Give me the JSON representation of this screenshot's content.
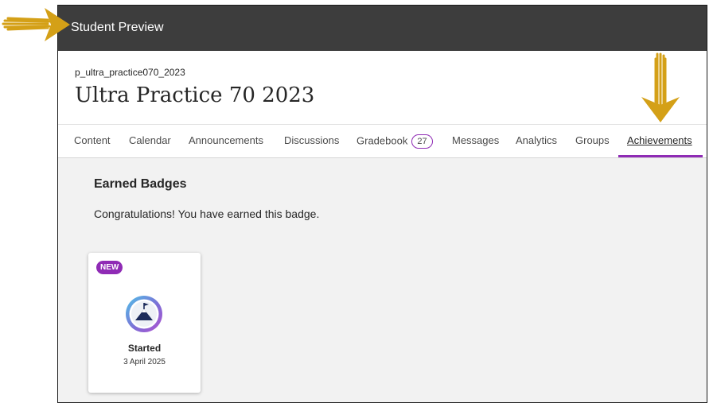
{
  "preview_bar": {
    "title": "Student Preview"
  },
  "course": {
    "id": "p_ultra_practice070_2023",
    "title": "Ultra Practice 70 2023"
  },
  "tabs": [
    {
      "label": "Content"
    },
    {
      "label": "Calendar"
    },
    {
      "label": "Announcements"
    },
    {
      "label": "Discussions"
    },
    {
      "label": "Gradebook",
      "count": "27"
    },
    {
      "label": "Messages"
    },
    {
      "label": "Analytics"
    },
    {
      "label": "Groups"
    },
    {
      "label": "Achievements",
      "active": true
    }
  ],
  "main": {
    "heading": "Earned Badges",
    "message": "Congratulations! You have earned this badge."
  },
  "badge_card": {
    "new_label": "NEW",
    "name": "Started",
    "date": "3 April 2025",
    "icon": "mountain-flag-icon"
  },
  "annotations": {
    "arrow_color": "#d4a017",
    "icon_left": "arrow-right-icon",
    "icon_down": "arrow-down-icon"
  },
  "colors": {
    "accent": "#8f2bb5",
    "preview_bar": "#3d3d3d",
    "content_bg": "#f2f2f2"
  }
}
